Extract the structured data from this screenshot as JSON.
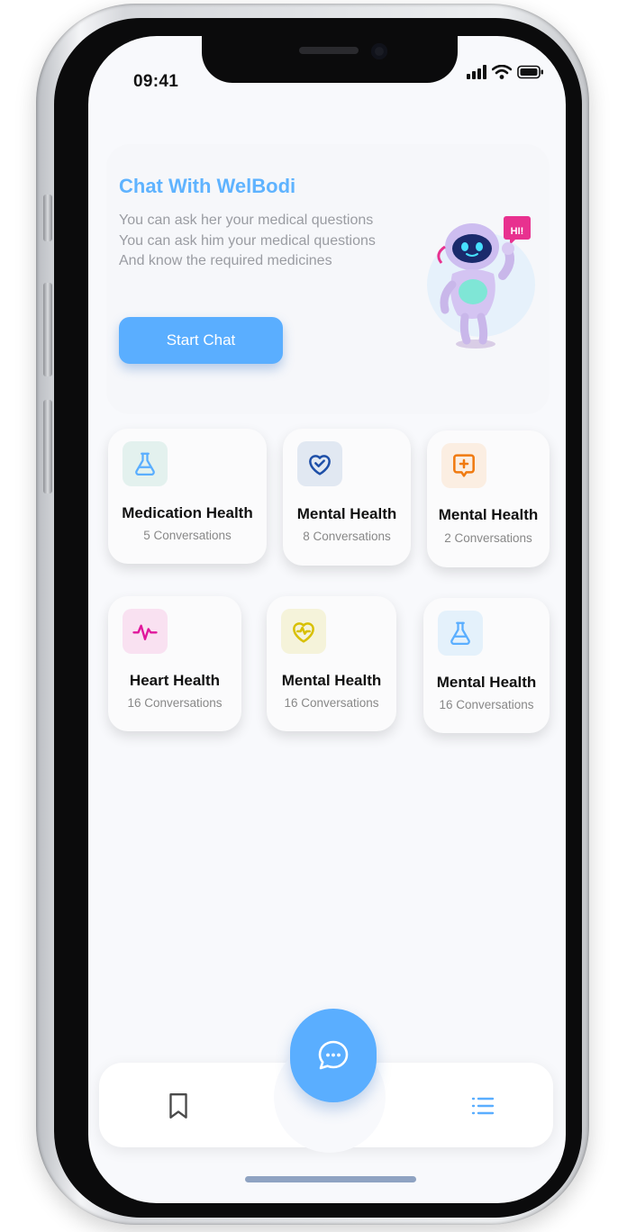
{
  "status_bar": {
    "time": "09:41"
  },
  "hero": {
    "title": "Chat With WelBodi",
    "lines": [
      "You can ask her your medical questions",
      "You can ask him your medical questions",
      "And know the required medicines"
    ],
    "button_label": "Start Chat",
    "robot_bubble": "HI!"
  },
  "categories": [
    {
      "title": "Medication Health",
      "subtitle": "5 Conversations",
      "icon": "flask-icon",
      "color": "#5aaeff",
      "bg": "#e3f1ee"
    },
    {
      "title": "Mental Health",
      "subtitle": "8 Conversations",
      "icon": "heart-check-icon",
      "color": "#1e4fa8",
      "bg": "#e1e8f2"
    },
    {
      "title": "Mental Health",
      "subtitle": "2 Conversations",
      "icon": "chat-plus-icon",
      "color": "#f07a10",
      "bg": "#fbeee2"
    },
    {
      "title": "Heart Health",
      "subtitle": "16 Conversations",
      "icon": "pulse-icon",
      "color": "#e0189c",
      "bg": "#f9e1f1"
    },
    {
      "title": "Mental Health",
      "subtitle": "16 Conversations",
      "icon": "heart-pulse-icon",
      "color": "#d8c000",
      "bg": "#f5f3da"
    },
    {
      "title": "Mental Health",
      "subtitle": "16 Conversations",
      "icon": "flask-icon",
      "color": "#5aaeff",
      "bg": "#e4f1fb"
    }
  ],
  "nav": {
    "left_icon": "bookmark-icon",
    "center_icon": "chat-bubble-icon",
    "right_icon": "list-icon"
  },
  "colors": {
    "accent": "#5aaeff",
    "title": "#5fb3ff"
  }
}
